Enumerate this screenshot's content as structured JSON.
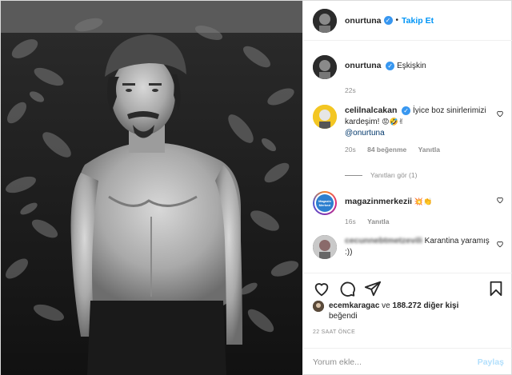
{
  "post_author": {
    "username": "onurtuna",
    "verified": true,
    "follow_label": "Takip Et",
    "separator": "•"
  },
  "caption": {
    "username": "onurtuna",
    "text": "Eşkişkin",
    "time": "22s"
  },
  "comments": [
    {
      "username": "celilnalcakan",
      "verified": true,
      "text": "İyice boz sinirlerimizi kardeşim!",
      "emoji": "😡🤣✌",
      "mention": "@onurtuna",
      "time": "20s",
      "likes": "84 beğenme",
      "reply": "Yanıtla"
    },
    {
      "username": "magazinmerkezii",
      "text": "",
      "emoji": "💥👏",
      "time": "16s",
      "reply": "Yanıtla",
      "avatar_text": "Magazin Merkezi"
    },
    {
      "username": "cecunnebtmetzevili",
      "text": "Karantina yaramış :))"
    }
  ],
  "replies_label": "Yanıtları gör (1)",
  "likes": {
    "user": "ecemkaragac",
    "connector": "ve",
    "count": "188.272 diğer kişi",
    "suffix": "beğendi"
  },
  "timestamp": "22 SAAT ÖNCE",
  "add_comment": {
    "placeholder": "Yorum ekle...",
    "post_label": "Paylaş"
  },
  "icons": {
    "like": "heart-icon",
    "comment": "comment-icon",
    "share": "share-icon",
    "save": "bookmark-icon"
  }
}
